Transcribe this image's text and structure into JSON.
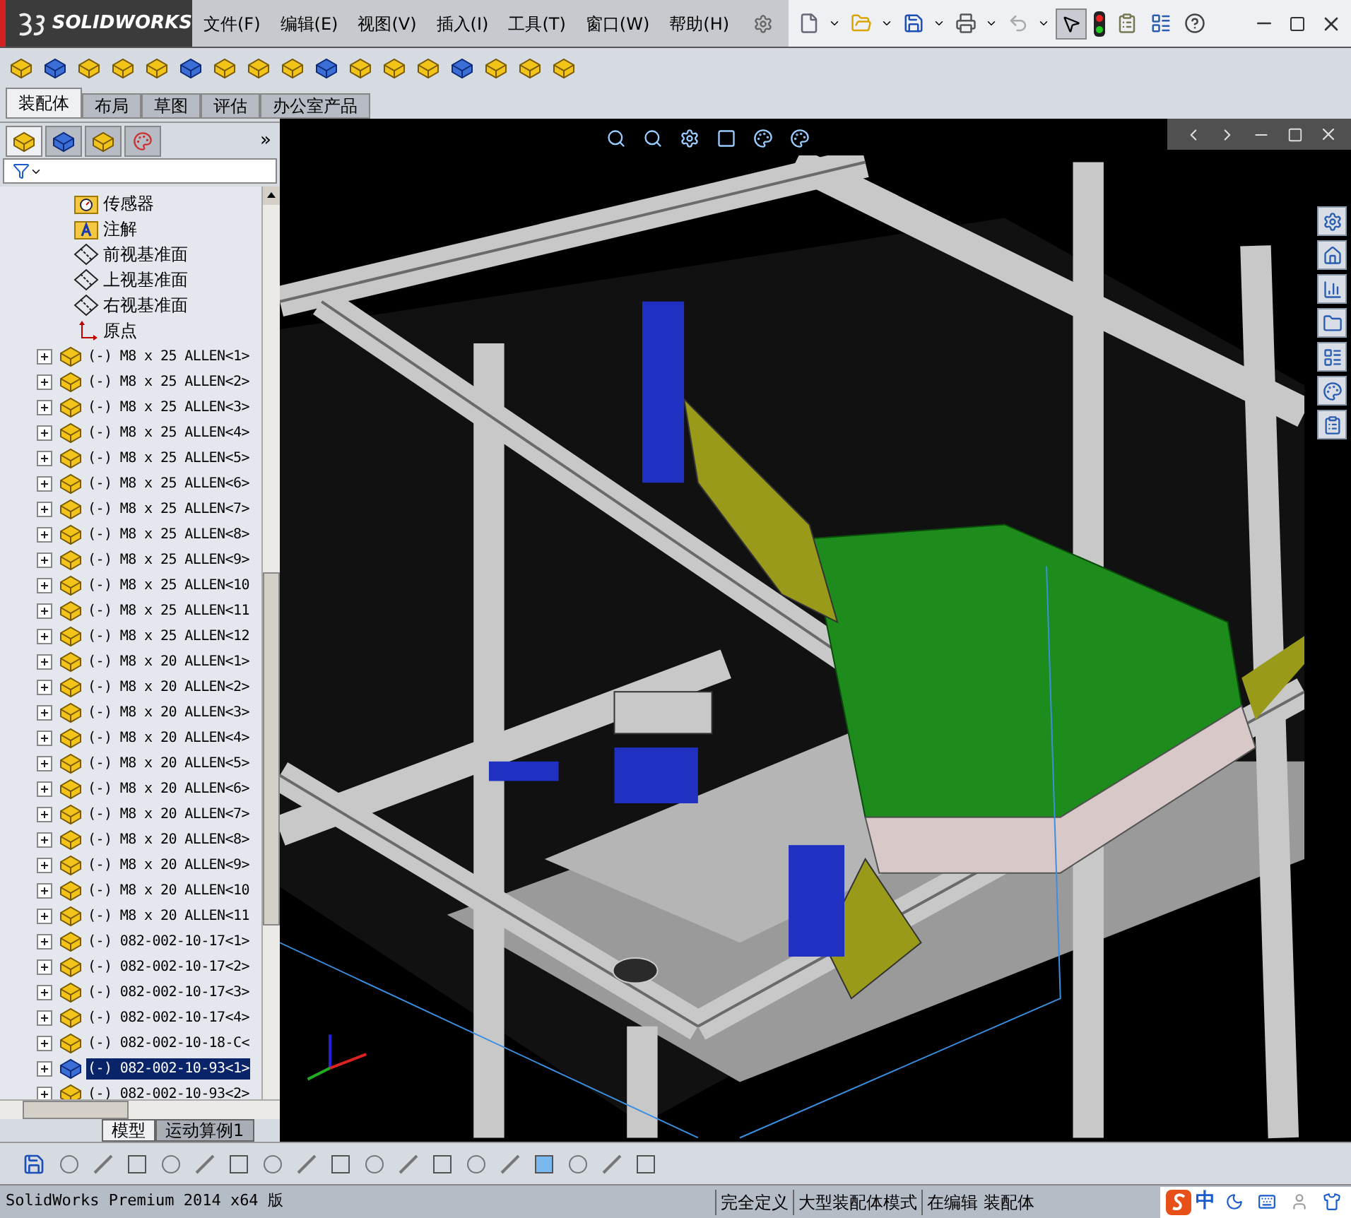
{
  "app": {
    "logo": "SOLIDWORKS"
  },
  "menu": [
    {
      "label": "文件(F)"
    },
    {
      "label": "编辑(E)"
    },
    {
      "label": "视图(V)"
    },
    {
      "label": "插入(I)"
    },
    {
      "label": "工具(T)"
    },
    {
      "label": "窗口(W)"
    },
    {
      "label": "帮助(H)"
    }
  ],
  "command_tabs": [
    {
      "label": "装配体",
      "selected": true
    },
    {
      "label": "布局",
      "selected": false
    },
    {
      "label": "草图",
      "selected": false
    },
    {
      "label": "评估",
      "selected": false
    },
    {
      "label": "办公室产品",
      "selected": false
    }
  ],
  "panel_tabs": [
    {
      "selected": true
    },
    {
      "selected": false
    },
    {
      "selected": false
    },
    {
      "selected": false
    }
  ],
  "panel_more": "»",
  "tree": [
    {
      "text": "传感器",
      "kind": "sensor",
      "selected": false
    },
    {
      "text": "注解",
      "kind": "annotation",
      "selected": false
    },
    {
      "text": "前视基准面",
      "kind": "plane",
      "selected": false
    },
    {
      "text": "上视基准面",
      "kind": "plane",
      "selected": false
    },
    {
      "text": "右视基准面",
      "kind": "plane",
      "selected": false
    },
    {
      "text": "原点",
      "kind": "origin",
      "selected": false
    },
    {
      "text": "(-) M8 x 25 ALLEN<1>",
      "kind": "component",
      "selected": false
    },
    {
      "text": "(-) M8 x 25 ALLEN<2>",
      "kind": "component",
      "selected": false
    },
    {
      "text": "(-) M8 x 25 ALLEN<3>",
      "kind": "component",
      "selected": false
    },
    {
      "text": "(-) M8 x 25 ALLEN<4>",
      "kind": "component",
      "selected": false
    },
    {
      "text": "(-) M8 x 25 ALLEN<5>",
      "kind": "component",
      "selected": false
    },
    {
      "text": "(-) M8 x 25 ALLEN<6>",
      "kind": "component",
      "selected": false
    },
    {
      "text": "(-) M8 x 25 ALLEN<7>",
      "kind": "component",
      "selected": false
    },
    {
      "text": "(-) M8 x 25 ALLEN<8>",
      "kind": "component",
      "selected": false
    },
    {
      "text": "(-) M8 x 25 ALLEN<9>",
      "kind": "component",
      "selected": false
    },
    {
      "text": "(-) M8 x 25 ALLEN<10",
      "kind": "component",
      "selected": false
    },
    {
      "text": "(-) M8 x 25 ALLEN<11",
      "kind": "component",
      "selected": false
    },
    {
      "text": "(-) M8 x 25 ALLEN<12",
      "kind": "component",
      "selected": false
    },
    {
      "text": "(-) M8 x 20 ALLEN<1>",
      "kind": "component",
      "selected": false
    },
    {
      "text": "(-) M8 x 20 ALLEN<2>",
      "kind": "component",
      "selected": false
    },
    {
      "text": "(-) M8 x 20 ALLEN<3>",
      "kind": "component",
      "selected": false
    },
    {
      "text": "(-) M8 x 20 ALLEN<4>",
      "kind": "component",
      "selected": false
    },
    {
      "text": "(-) M8 x 20 ALLEN<5>",
      "kind": "component",
      "selected": false
    },
    {
      "text": "(-) M8 x 20 ALLEN<6>",
      "kind": "component",
      "selected": false
    },
    {
      "text": "(-) M8 x 20 ALLEN<7>",
      "kind": "component",
      "selected": false
    },
    {
      "text": "(-) M8 x 20 ALLEN<8>",
      "kind": "component",
      "selected": false
    },
    {
      "text": "(-) M8 x 20 ALLEN<9>",
      "kind": "component",
      "selected": false
    },
    {
      "text": "(-) M8 x 20 ALLEN<10",
      "kind": "component",
      "selected": false
    },
    {
      "text": "(-) M8 x 20 ALLEN<11",
      "kind": "component",
      "selected": false
    },
    {
      "text": "(-) 082-002-10-17<1>",
      "kind": "component",
      "selected": false
    },
    {
      "text": "(-) 082-002-10-17<2>",
      "kind": "component",
      "selected": false
    },
    {
      "text": "(-) 082-002-10-17<3>",
      "kind": "component",
      "selected": false
    },
    {
      "text": "(-) 082-002-10-17<4>",
      "kind": "component",
      "selected": false
    },
    {
      "text": "(-) 082-002-10-18-C<",
      "kind": "component",
      "selected": false
    },
    {
      "text": "(-) 082-002-10-93<1>",
      "kind": "component",
      "selected": true
    },
    {
      "text": "(-) 082-002-10-93<2>",
      "kind": "component",
      "selected": false
    }
  ],
  "bottom_tabs": [
    {
      "label": "模型",
      "selected": true
    },
    {
      "label": "运动算例1",
      "selected": false
    }
  ],
  "status_bar": {
    "product": "SolidWorks Premium 2014 x64 版",
    "fields": [
      "完全定义",
      "大型装配体模式",
      "在编辑 装配体"
    ],
    "ime": "中"
  }
}
